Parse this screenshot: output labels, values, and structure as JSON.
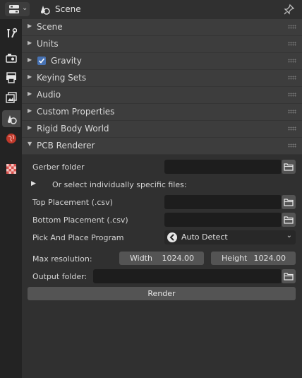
{
  "header": {
    "title": "Scene"
  },
  "panels": [
    {
      "label": "Scene"
    },
    {
      "label": "Units"
    },
    {
      "label": "Gravity",
      "checked": true
    },
    {
      "label": "Keying Sets"
    },
    {
      "label": "Audio"
    },
    {
      "label": "Custom Properties"
    },
    {
      "label": "Rigid Body World"
    },
    {
      "label": "PCB Renderer",
      "expanded": true
    }
  ],
  "pcb": {
    "gerber_label": "Gerber folder",
    "select_files_label": "Or select individually specific files:",
    "top_label": "Top Placement (.csv)",
    "bottom_label": "Bottom Placement (.csv)",
    "pick_place_label": "Pick And Place Program",
    "pick_place_value": "Auto Detect",
    "max_res_label": "Max resolution:",
    "width_label": "Width",
    "width_value": "1024.00",
    "height_label": "Height",
    "height_value": "1024.00",
    "output_label": "Output folder:",
    "render_label": "Render"
  },
  "colors": {
    "accent": "#4772b3",
    "panel_bg": "#3d3d3d",
    "field_bg": "#1d1d1d"
  }
}
